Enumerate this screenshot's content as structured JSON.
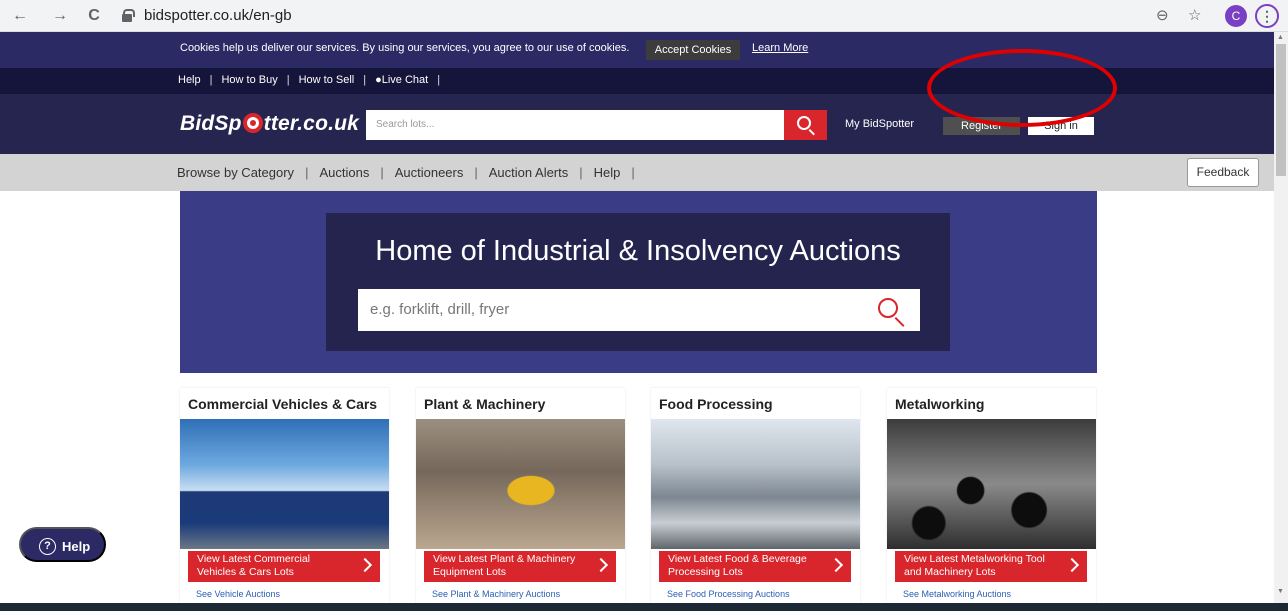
{
  "browser": {
    "back": "←",
    "forward": "→",
    "reload": "C",
    "url": "bidspotter.co.uk/en-gb",
    "zoom_icon": "⊖",
    "star_icon": "☆",
    "avatar_letter": "C",
    "menu_icon": "⋮"
  },
  "cookie": {
    "message": "Cookies help us deliver our services. By using our services, you agree to our use of cookies.",
    "accept": "Accept Cookies",
    "learn_more": "Learn More"
  },
  "topnav": {
    "help": "Help",
    "how_to_buy": "How to Buy",
    "how_to_sell": "How to Sell",
    "live_chat": "Live Chat"
  },
  "header": {
    "logo_before": "BidSp",
    "logo_after": "tter.co.uk",
    "search_placeholder": "Search lots...",
    "my_bidspotter": "My BidSpotter",
    "register": "Register",
    "sign_in": "Sign in"
  },
  "catnav": {
    "browse": "Browse by Category",
    "auctions": "Auctions",
    "auctioneers": "Auctioneers",
    "alerts": "Auction Alerts",
    "help": "Help",
    "feedback": "Feedback"
  },
  "hero": {
    "title": "Home of Industrial & Insolvency Auctions",
    "search_placeholder": "e.g. forklift, drill, fryer"
  },
  "cards": [
    {
      "title": "Commercial Vehicles & Cars",
      "cta": "View Latest Commercial Vehicles & Cars Lots",
      "link": "See Vehicle Auctions"
    },
    {
      "title": "Plant & Machinery",
      "cta": "View Latest Plant & Machinery Equipment Lots",
      "link": "See Plant & Machinery Auctions"
    },
    {
      "title": "Food Processing",
      "cta": "View Latest Food & Beverage Processing Lots",
      "link": "See Food Processing Auctions"
    },
    {
      "title": "Metalworking",
      "cta": "View Latest Metalworking Tool and Machinery Lots",
      "link": "See Metalworking Auctions"
    }
  ],
  "help_button": "Help",
  "colors": {
    "brand_navy": "#26254f",
    "hero_blue": "#3b3c86",
    "accent_red": "#d9262c"
  }
}
